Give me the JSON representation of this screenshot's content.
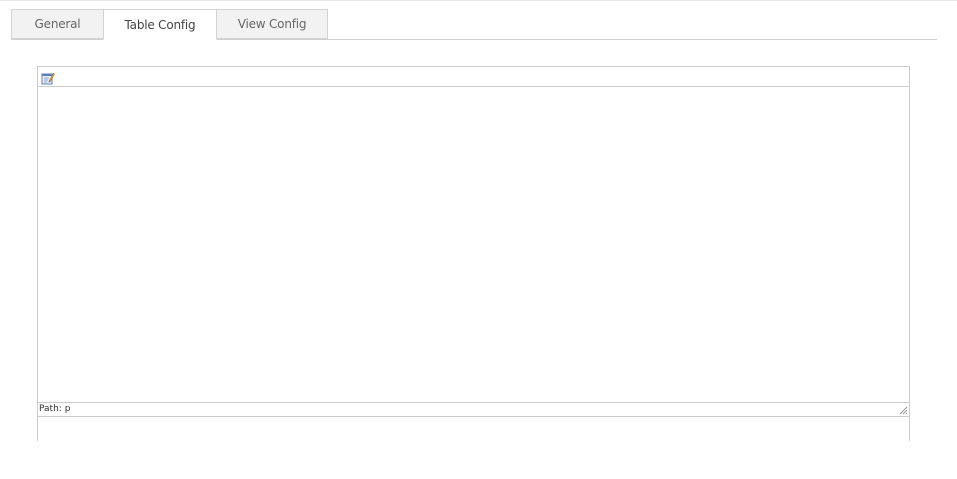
{
  "tabs": [
    {
      "label": "General",
      "active": false
    },
    {
      "label": "Table Config",
      "active": true
    },
    {
      "label": "View Config",
      "active": false
    }
  ],
  "editor": {
    "toolbar": {
      "buttons": [
        {
          "icon": "edit-source-icon"
        }
      ]
    },
    "content": "",
    "statusbar": {
      "path_label": "Path:",
      "path_value": "p"
    }
  },
  "colors": {
    "tab_bg": "#f2f2f2",
    "tab_active_bg": "#ffffff",
    "border": "#cccccc",
    "text": "#666666"
  }
}
